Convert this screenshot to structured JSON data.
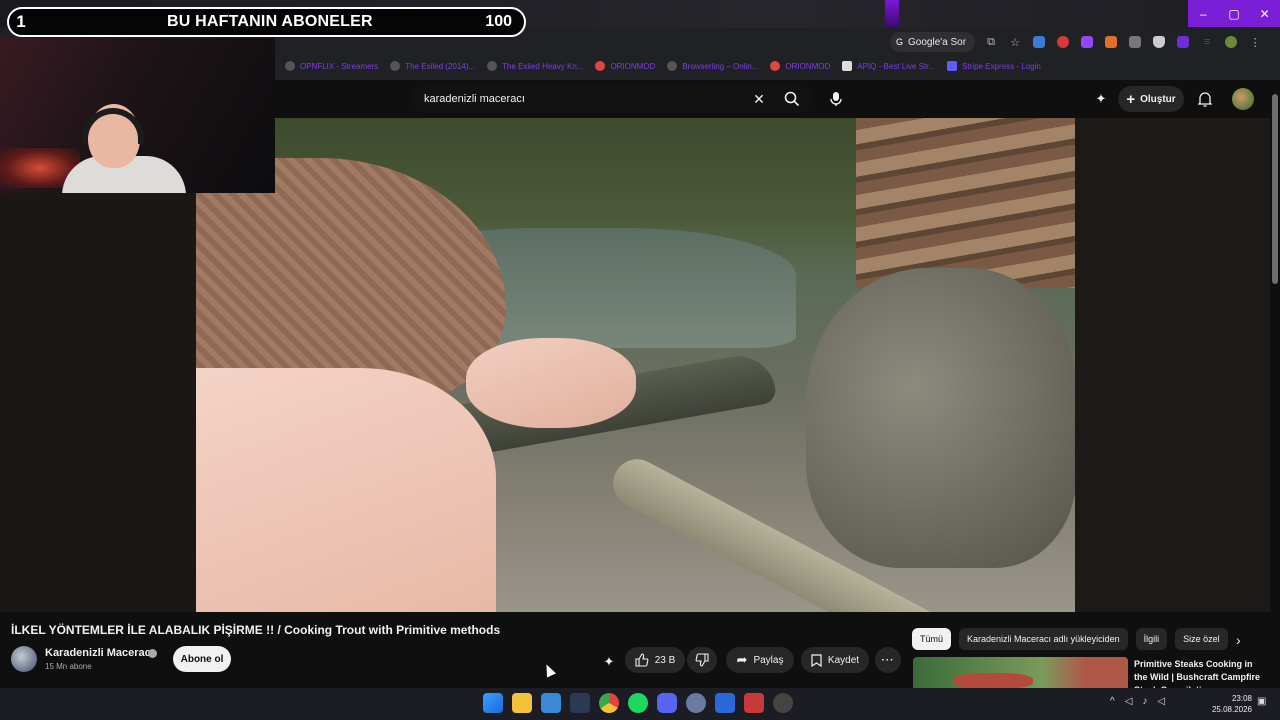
{
  "overlay": {
    "rank": "1",
    "title": "BU HAFTANIN ABONELER",
    "count": "100"
  },
  "browser": {
    "ask_google": "Google'a Sor",
    "window_controls": [
      "–",
      "▢",
      "✕"
    ],
    "bookmarks": [
      {
        "label": "OPNFLIX - Streamers",
        "icon": "circle-icon"
      },
      {
        "label": "The Exiled (2014)...",
        "icon": "crown-icon"
      },
      {
        "label": "The Exiled Heavy Kn...",
        "icon": "crown-icon"
      },
      {
        "label": "ORIONMOD",
        "icon": "patreon-icon"
      },
      {
        "label": "Browserling – Onlin...",
        "icon": "browser-icon"
      },
      {
        "label": "ORIONMOD",
        "icon": "patreon-icon"
      },
      {
        "label": "APIQ - Best Live Str...",
        "icon": "bookmark-icon"
      },
      {
        "label": "Stripe Express - Login",
        "icon": "stripe-icon"
      }
    ]
  },
  "youtube": {
    "search_value": "karadenizli maceracı",
    "create_label": "Oluştur",
    "video_title": "İLKEL YÖNTEMLER İLE ALABALIK PİŞİRME !! / Cooking Trout with Primitive methods",
    "channel_name": "Karadenizli Maceracı",
    "subscriber_count": "15 Mn abone",
    "subscribe_label": "Abone ol",
    "like_count": "23 B",
    "share_label": "Paylaş",
    "save_label": "Kaydet",
    "chips": [
      "Tümü",
      "Karadenizli Maceracı adlı yükleyiciden",
      "İlgili",
      "Size özel"
    ],
    "recommended_title": "Primitive Steaks Cooking in the Wild | Bushcraft Campfire Steak Compilation"
  },
  "taskbar": {
    "time": "23:08",
    "date": "25.08.2026"
  },
  "colors": {
    "accent_purple": "#7a1fd6",
    "yt_background": "#0f0f0f"
  }
}
